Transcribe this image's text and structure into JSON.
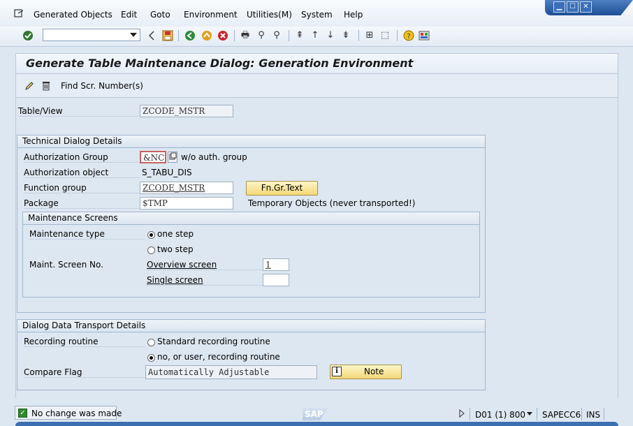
{
  "menu": {
    "items": [
      "Generated Objects",
      "Edit",
      "Goto",
      "Environment",
      "Utilities(M)",
      "System",
      "Help"
    ]
  },
  "window_controls": {
    "minimize": "▁",
    "maximize": "☐",
    "close": "✕"
  },
  "toolbar": {
    "command_value": ""
  },
  "screen": {
    "title": "Generate Table Maintenance Dialog: Generation Environment",
    "find_button": "Find Scr. Number(s)"
  },
  "table_view": {
    "label": "Table/View",
    "value": "ZCODE_MSTR"
  },
  "technical": {
    "header": "Technical Dialog Details",
    "auth_group_label": "Authorization Group",
    "auth_group_value": "&NC&",
    "auth_group_hint": "w/o auth. group",
    "auth_object_label": "Authorization object",
    "auth_object_value": "S_TABU_DIS",
    "function_group_label": "Function group",
    "function_group_value": "ZCODE_MSTR",
    "fn_gr_text_button": "Fn.Gr.Text",
    "package_label": "Package",
    "package_value": "$TMP",
    "package_desc": "Temporary Objects (never transported!)"
  },
  "maintenance": {
    "header": "Maintenance Screens",
    "type_label": "Maintenance type",
    "one_step": "one step",
    "two_step": "two step",
    "selected": "one step",
    "screen_no_label": "Maint. Screen No.",
    "overview_label": "Overview screen",
    "overview_value": "1",
    "single_label": "Single screen",
    "single_value": ""
  },
  "transport": {
    "header": "Dialog Data Transport Details",
    "recording_label": "Recording routine",
    "standard_option": "Standard recording routine",
    "user_option": "no, or user, recording routine",
    "selected": "no, or user, recording routine",
    "compare_label": "Compare Flag",
    "compare_value": "Automatically Adjustable",
    "note_button": "Note"
  },
  "status": {
    "message": "No change was made",
    "sap_logo": "SAP",
    "system": "D01 (1) 800",
    "server": "SAPECC6",
    "mode": "INS"
  }
}
